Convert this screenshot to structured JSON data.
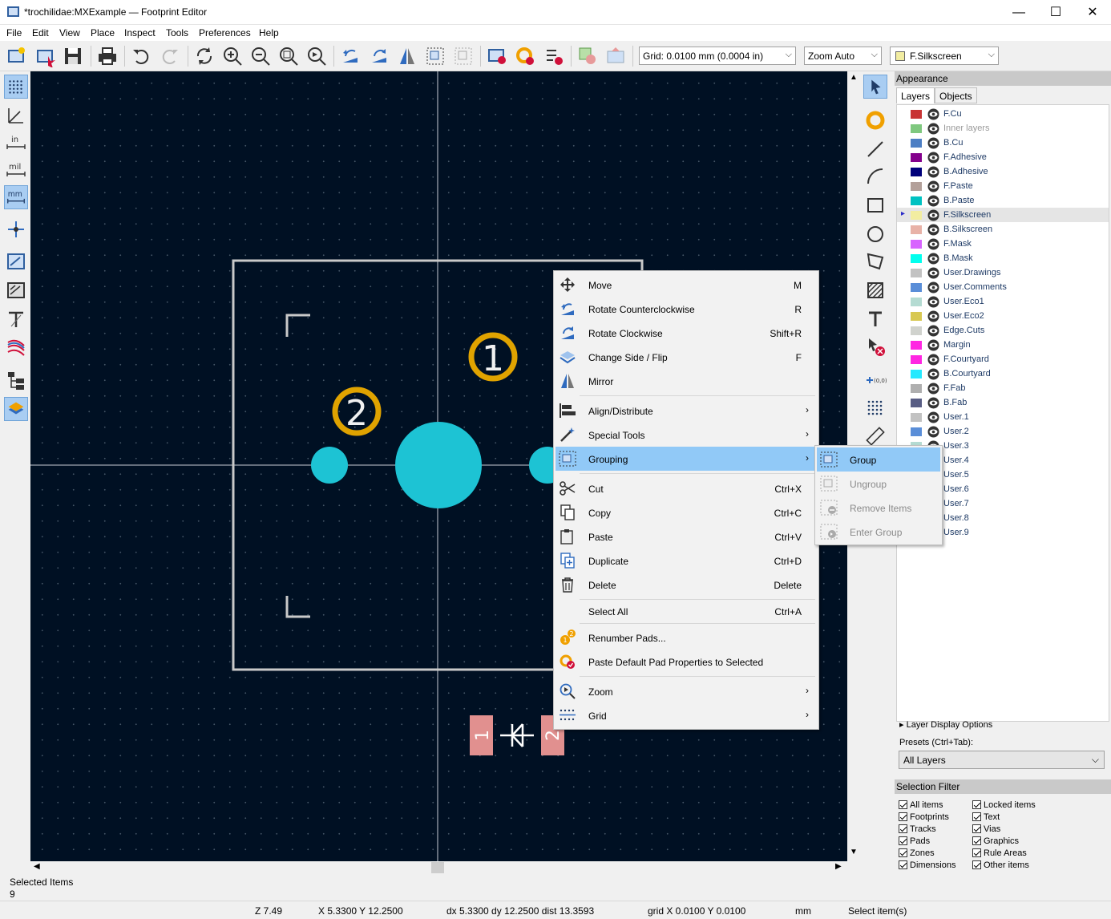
{
  "window": {
    "title": "*trochilidae:MXExample — Footprint Editor",
    "minimize": "—",
    "maximize": "☐",
    "close": "✕"
  },
  "menu": [
    "File",
    "Edit",
    "View",
    "Place",
    "Inspect",
    "Tools",
    "Preferences",
    "Help"
  ],
  "toolbar": {
    "grid": "Grid: 0.0100 mm (0.0004 in)",
    "zoom": "Zoom Auto",
    "layer": "F.Silkscreen",
    "layer_color": "#f2eda1"
  },
  "canvas": {
    "pad1_label": "1",
    "pad2_label": "2",
    "smd1_label": "1",
    "smd2_label": "2"
  },
  "context_menu": {
    "items": [
      {
        "label": "Move",
        "shortcut": "M"
      },
      {
        "label": "Rotate Counterclockwise",
        "shortcut": "R"
      },
      {
        "label": "Rotate Clockwise",
        "shortcut": "Shift+R"
      },
      {
        "label": "Change Side / Flip",
        "shortcut": "F"
      },
      {
        "label": "Mirror",
        "shortcut": ""
      },
      {
        "label": "Align/Distribute",
        "shortcut": ""
      },
      {
        "label": "Special Tools",
        "shortcut": ""
      },
      {
        "label": "Grouping",
        "shortcut": ""
      },
      {
        "label": "Cut",
        "shortcut": "Ctrl+X"
      },
      {
        "label": "Copy",
        "shortcut": "Ctrl+C"
      },
      {
        "label": "Paste",
        "shortcut": "Ctrl+V"
      },
      {
        "label": "Duplicate",
        "shortcut": "Ctrl+D"
      },
      {
        "label": "Delete",
        "shortcut": "Delete"
      },
      {
        "label": "Select All",
        "shortcut": "Ctrl+A"
      },
      {
        "label": "Renumber Pads...",
        "shortcut": ""
      },
      {
        "label": "Paste Default Pad Properties to Selected",
        "shortcut": ""
      },
      {
        "label": "Zoom",
        "shortcut": ""
      },
      {
        "label": "Grid",
        "shortcut": ""
      }
    ],
    "submenu_arrow": "›"
  },
  "submenu": {
    "items": [
      "Group",
      "Ungroup",
      "Remove Items",
      "Enter Group"
    ]
  },
  "appearance": {
    "title": "Appearance",
    "tabs": [
      "Layers",
      "Objects"
    ],
    "layers": [
      {
        "name": "F.Cu",
        "color": "#c83434"
      },
      {
        "name": "Inner layers",
        "color": "#7fc87f"
      },
      {
        "name": "B.Cu",
        "color": "#4d7fc4"
      },
      {
        "name": "F.Adhesive",
        "color": "#84008c"
      },
      {
        "name": "B.Adhesive",
        "color": "#00007a"
      },
      {
        "name": "F.Paste",
        "color": "#b3a09a"
      },
      {
        "name": "B.Paste",
        "color": "#00c2c2"
      },
      {
        "name": "F.Silkscreen",
        "color": "#f2eda1"
      },
      {
        "name": "B.Silkscreen",
        "color": "#e8b2a7"
      },
      {
        "name": "F.Mask",
        "color": "#d864ff"
      },
      {
        "name": "B.Mask",
        "color": "#02ffee"
      },
      {
        "name": "User.Drawings",
        "color": "#c2c2c2"
      },
      {
        "name": "User.Comments",
        "color": "#5a8ed8"
      },
      {
        "name": "User.Eco1",
        "color": "#b4dbd2"
      },
      {
        "name": "User.Eco2",
        "color": "#d8c852"
      },
      {
        "name": "Edge.Cuts",
        "color": "#d0d2cd"
      },
      {
        "name": "Margin",
        "color": "#ff26e2"
      },
      {
        "name": "F.Courtyard",
        "color": "#ff26e2"
      },
      {
        "name": "B.Courtyard",
        "color": "#26e9ff"
      },
      {
        "name": "F.Fab",
        "color": "#afafaf"
      },
      {
        "name": "B.Fab",
        "color": "#585d84"
      },
      {
        "name": "User.1",
        "color": "#c2c2c2"
      },
      {
        "name": "User.2",
        "color": "#5a8ed8"
      },
      {
        "name": "User.3",
        "color": "#b4dbd2"
      },
      {
        "name": "User.4",
        "color": "#d8c852"
      },
      {
        "name": "User.5",
        "color": "#c2c2c2"
      },
      {
        "name": "User.6",
        "color": "#5a8ed8"
      },
      {
        "name": "User.7",
        "color": "#b4dbd2"
      },
      {
        "name": "User.8",
        "color": "#d8c852"
      },
      {
        "name": "User.9",
        "color": "#c2c2c2"
      }
    ],
    "layer_display_options": "Layer Display Options",
    "presets_label": "Presets (Ctrl+Tab):",
    "presets_value": "All Layers"
  },
  "selection_filter": {
    "title": "Selection Filter",
    "items": [
      "All items",
      "Locked items",
      "Footprints",
      "Text",
      "Tracks",
      "Vias",
      "Pads",
      "Graphics",
      "Zones",
      "Rule Areas",
      "Dimensions",
      "Other items"
    ]
  },
  "message": {
    "label": "Selected Items",
    "value": "9"
  },
  "status": {
    "z": "Z 7.49",
    "xy": "X 5.3300  Y 12.2500",
    "dxy": "dx 5.3300  dy 12.2500  dist 13.3593",
    "grid": "grid X 0.0100  Y 0.0100",
    "units": "mm",
    "action": "Select item(s)"
  }
}
